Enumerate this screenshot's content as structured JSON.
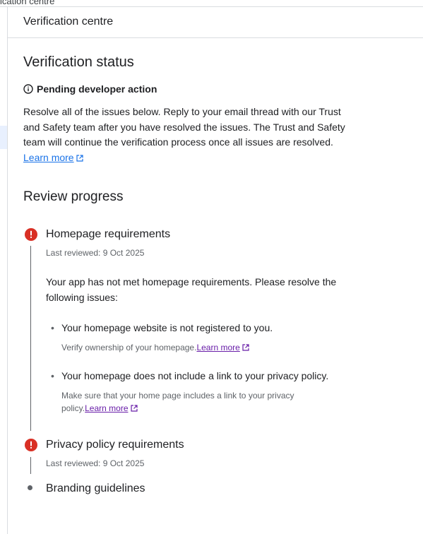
{
  "top_crumb": "ication centre",
  "header": {
    "title": "Verification centre"
  },
  "status": {
    "heading": "Verification status",
    "state": "Pending developer action",
    "description": "Resolve all of the issues below. Reply to your email thread with our Trust and Safety team after you have resolved the issues. The Trust and Safety team will continue the verification process once all issues are resolved.",
    "learn_more": "Learn more"
  },
  "review": {
    "heading": "Review progress",
    "steps": [
      {
        "title": "Homepage requirements",
        "reviewed": "Last reviewed: 9 Oct 2025",
        "description": "Your app has not met homepage requirements. Please resolve the following issues:",
        "issues": [
          {
            "title": "Your homepage website is not registered to you.",
            "detail": "Verify ownership of your homepage.",
            "link": "Learn more"
          },
          {
            "title": "Your homepage does not include a link to your privacy policy.",
            "detail": "Make sure that your home page includes a link to your privacy policy.",
            "link": "Learn more"
          }
        ]
      },
      {
        "title": "Privacy policy requirements",
        "reviewed": "Last reviewed: 9 Oct 2025"
      },
      {
        "title": "Branding guidelines"
      }
    ]
  },
  "colors": {
    "error": "#d93025",
    "link": "#1a73e8",
    "visited_link": "#681da8",
    "border": "#dadce0",
    "muted": "#5f6368"
  }
}
